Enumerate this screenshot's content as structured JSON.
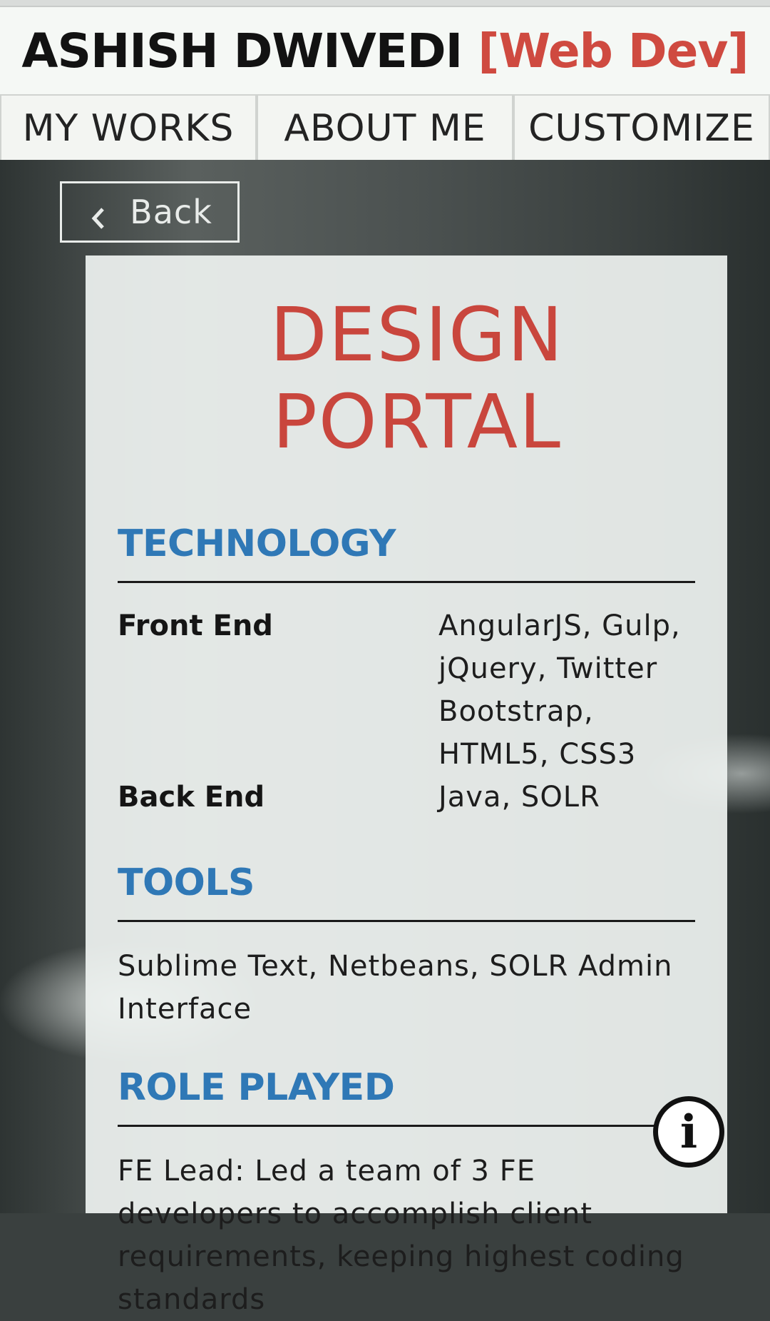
{
  "header": {
    "name": "ASHISH DWIVEDI",
    "role": "[Web Dev]"
  },
  "nav": {
    "tabs": [
      {
        "label": "MY WORKS"
      },
      {
        "label": "ABOUT ME"
      },
      {
        "label": "CUSTOMIZE"
      }
    ]
  },
  "back": {
    "label": "Back",
    "icon": "chevron-left-icon"
  },
  "project": {
    "title": "DESIGN PORTAL",
    "technology": {
      "heading": "TECHNOLOGY",
      "rows": [
        {
          "label": "Front End",
          "value": "AngularJS, Gulp, jQuery, Twitter Bootstrap, HTML5, CSS3"
        },
        {
          "label": "Back End",
          "value": "Java, SOLR"
        }
      ]
    },
    "tools": {
      "heading": "TOOLS",
      "text": "Sublime Text, Netbeans, SOLR Admin Interface"
    },
    "role": {
      "heading": "ROLE PLAYED",
      "text": "FE Lead: Led a team of 3 FE developers to accomplish client requirements, keeping highest coding standards"
    }
  },
  "info": {
    "icon": "info-icon",
    "glyph": "i"
  },
  "colors": {
    "accent_red": "#cf4a40",
    "heading_blue": "#2f78b6"
  }
}
